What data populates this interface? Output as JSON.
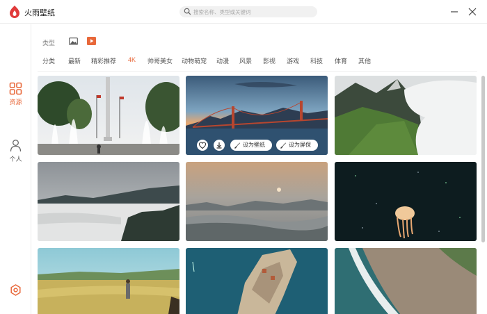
{
  "app": {
    "title": "火雨壁纸",
    "brand_color": "#e8683a"
  },
  "search": {
    "placeholder": "搜索名称、类型或关键词"
  },
  "window_controls": [
    "minimize-icon",
    "close-icon"
  ],
  "sidebar": {
    "items": [
      {
        "label": "资源",
        "icon": "grid-icon",
        "active": true
      },
      {
        "label": "个人",
        "icon": "person-icon",
        "active": false
      }
    ],
    "bottom_icon": "settings-icon"
  },
  "filters": {
    "type_label": "类型",
    "type_options": [
      {
        "icon": "image-icon",
        "selected": false
      },
      {
        "icon": "video-icon",
        "selected": true
      }
    ],
    "categories": [
      "分类",
      "最新",
      "精彩推荐",
      "4K",
      "帅哥美女",
      "动物萌宠",
      "动漫",
      "风景",
      "影视",
      "游戏",
      "科技",
      "体育",
      "其他"
    ],
    "active_category": "4K"
  },
  "grid": {
    "tiles": [
      {
        "scene": "fountain-plaza"
      },
      {
        "scene": "golden-gate-bridge",
        "hovered": true
      },
      {
        "scene": "mountain-clouds"
      },
      {
        "scene": "misty-hills"
      },
      {
        "scene": "foggy-sunrise"
      },
      {
        "scene": "jellyfish"
      },
      {
        "scene": "wheat-field"
      },
      {
        "scene": "coastal-fort"
      },
      {
        "scene": "ocean-shore"
      }
    ],
    "hover_actions": {
      "favorite_icon": "heart-icon",
      "download_icon": "download-icon",
      "set_wallpaper": "设为壁纸",
      "set_screensaver": "设为屏保"
    }
  }
}
